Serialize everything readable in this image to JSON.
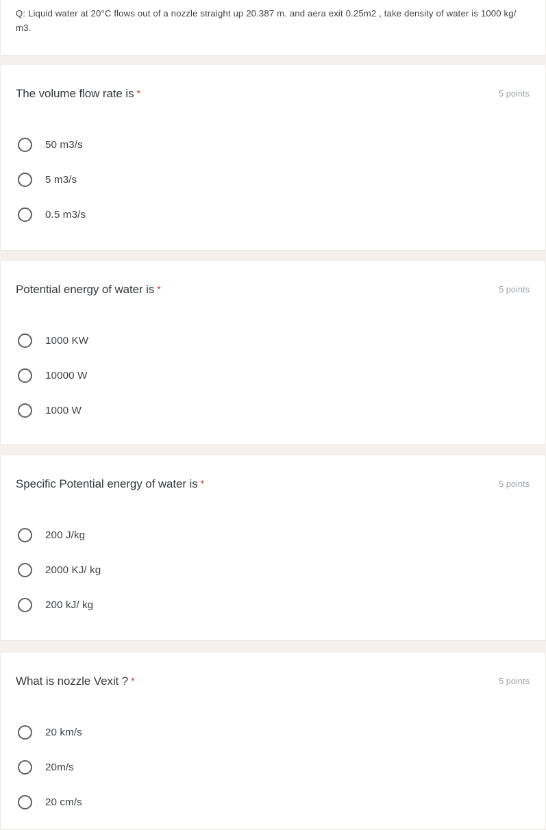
{
  "description": {
    "text": "Q: Liquid water at 20°C flows out of a nozzle straight up 20.387 m. and aera exit 0.25m2 , take density of water is 1000 kg/ m3."
  },
  "required_marker": "*",
  "colors": {
    "page_background": "#f4f1ec",
    "card_background": "#ffffff",
    "required_asterisk": "#d93025",
    "points_text": "#9aa0a6",
    "title_text": "#35393d",
    "option_text": "#3b3f43",
    "radio_border": "#5d6063"
  },
  "questions": [
    {
      "title": "The volume flow rate is",
      "points": "5 points",
      "options": [
        {
          "label": "50 m3/s",
          "selected": false
        },
        {
          "label": "5 m3/s",
          "selected": false
        },
        {
          "label": "0.5 m3/s",
          "selected": false
        }
      ]
    },
    {
      "title": "Potential energy of water is",
      "points": "5 points",
      "options": [
        {
          "label": "1000 KW",
          "selected": false
        },
        {
          "label": "10000 W",
          "selected": false
        },
        {
          "label": "1000 W",
          "selected": false
        }
      ]
    },
    {
      "title": "Specific Potential energy of water is",
      "points": "5 points",
      "options": [
        {
          "label": "200 J/kg",
          "selected": false
        },
        {
          "label": "2000 KJ/ kg",
          "selected": false
        },
        {
          "label": "200 kJ/ kg",
          "selected": false
        }
      ]
    },
    {
      "title": "What is nozzle Vexit ?",
      "points": "5 points",
      "options": [
        {
          "label": "20 km/s",
          "selected": false
        },
        {
          "label": "20m/s",
          "selected": false
        },
        {
          "label": "20 cm/s",
          "selected": false
        }
      ]
    }
  ]
}
